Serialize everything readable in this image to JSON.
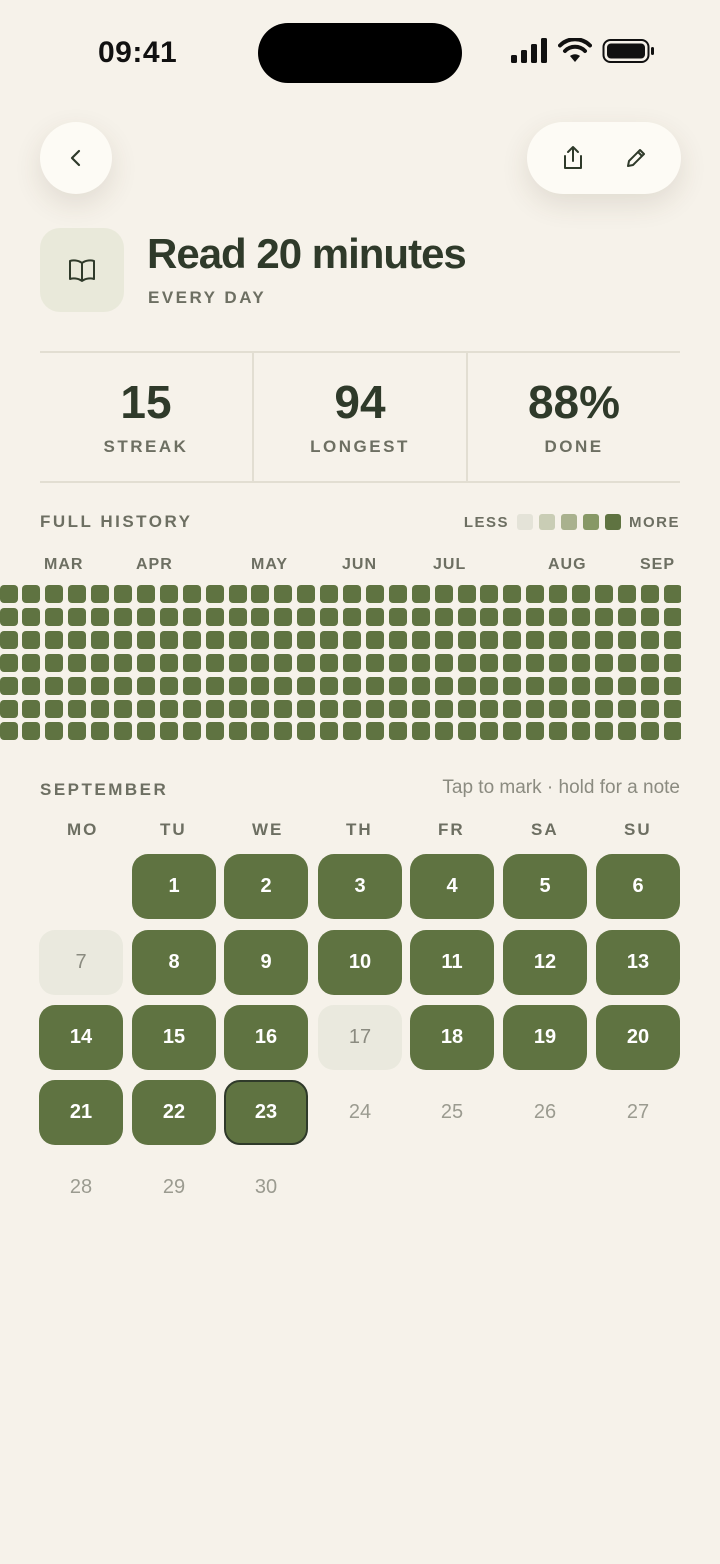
{
  "status": {
    "time": "09:41"
  },
  "header": {
    "back_icon": "chevron-left-icon",
    "share_icon": "share-icon",
    "edit_icon": "pencil-icon"
  },
  "habit": {
    "icon": "book-icon",
    "title": "Read 20 minutes",
    "frequency": "EVERY DAY"
  },
  "stats": [
    {
      "value": "15",
      "label": "STREAK"
    },
    {
      "value": "94",
      "label": "LONGEST"
    },
    {
      "value": "88%",
      "label": "DONE"
    }
  ],
  "history": {
    "label": "FULL HISTORY",
    "legend_less": "LESS",
    "legend_more": "MORE",
    "legend_colors": [
      "#e4e3d8",
      "#c9cdb5",
      "#a9b18e",
      "#879866",
      "#5f7341"
    ],
    "months": [
      "MAR",
      "APR",
      "MAY",
      "JUN",
      "JUL",
      "AUG",
      "SEP"
    ],
    "cell_color": "#5f7341"
  },
  "calendar": {
    "month": "SEPTEMBER",
    "hint": "Tap to mark · hold for a note",
    "weekdays": [
      "MO",
      "TU",
      "WE",
      "TH",
      "FR",
      "SA",
      "SU"
    ],
    "days": [
      {
        "d": "1",
        "s": "done"
      },
      {
        "d": "2",
        "s": "done"
      },
      {
        "d": "3",
        "s": "done"
      },
      {
        "d": "4",
        "s": "done"
      },
      {
        "d": "5",
        "s": "done"
      },
      {
        "d": "6",
        "s": "done"
      },
      {
        "d": "7",
        "s": "missed"
      },
      {
        "d": "8",
        "s": "done"
      },
      {
        "d": "9",
        "s": "done"
      },
      {
        "d": "10",
        "s": "done"
      },
      {
        "d": "11",
        "s": "done"
      },
      {
        "d": "12",
        "s": "done"
      },
      {
        "d": "13",
        "s": "done"
      },
      {
        "d": "14",
        "s": "done"
      },
      {
        "d": "15",
        "s": "done"
      },
      {
        "d": "16",
        "s": "done"
      },
      {
        "d": "17",
        "s": "missed"
      },
      {
        "d": "18",
        "s": "done"
      },
      {
        "d": "19",
        "s": "done"
      },
      {
        "d": "20",
        "s": "done"
      },
      {
        "d": "21",
        "s": "done"
      },
      {
        "d": "22",
        "s": "done"
      },
      {
        "d": "23",
        "s": "today"
      },
      {
        "d": "24",
        "s": "future"
      },
      {
        "d": "25",
        "s": "future"
      },
      {
        "d": "26",
        "s": "future"
      },
      {
        "d": "27",
        "s": "future"
      },
      {
        "d": "28",
        "s": "future"
      },
      {
        "d": "29",
        "s": "future"
      },
      {
        "d": "30",
        "s": "future"
      }
    ],
    "accent": "#5f7341"
  }
}
